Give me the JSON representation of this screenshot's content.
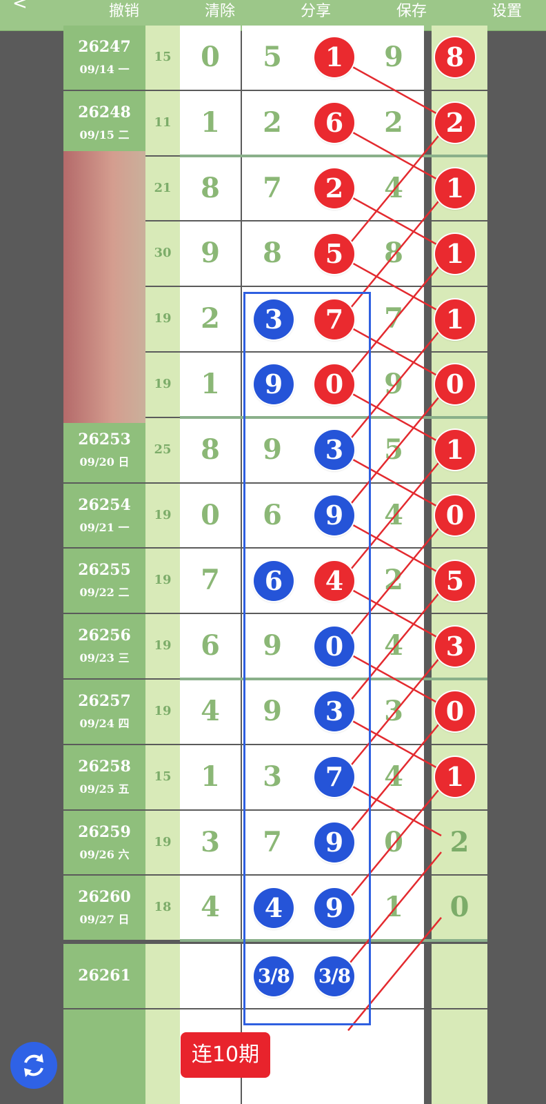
{
  "toolbar": {
    "back": "<",
    "undo": "撤销",
    "clear": "清除",
    "share": "分享",
    "save": "保存",
    "settings": "设置"
  },
  "colors": {
    "red_ball": "#ea2a2f",
    "blue_ball": "#2554d8",
    "green_header": "#9cc789"
  },
  "rows": [
    {
      "period": "26247",
      "date": "09/14 一",
      "sum": "15",
      "digits": [
        "0",
        "5",
        "1",
        "9",
        "8"
      ],
      "balls": {
        "2": "red",
        "4": "red"
      }
    },
    {
      "period": "26248",
      "date": "09/15 二",
      "sum": "11",
      "digits": [
        "1",
        "2",
        "6",
        "2",
        "2"
      ],
      "balls": {
        "2": "red",
        "4": "red"
      }
    },
    {
      "period": "",
      "date": "",
      "sum": "21",
      "digits": [
        "8",
        "7",
        "2",
        "4",
        "1"
      ],
      "balls": {
        "2": "red",
        "4": "red"
      }
    },
    {
      "period": "",
      "date": "",
      "sum": "30",
      "digits": [
        "9",
        "8",
        "5",
        "8",
        "1"
      ],
      "balls": {
        "2": "red",
        "4": "red"
      }
    },
    {
      "period": "",
      "date": "",
      "sum": "19",
      "digits": [
        "2",
        "3",
        "7",
        "7",
        "1"
      ],
      "balls": {
        "1": "blue",
        "2": "red",
        "4": "red"
      }
    },
    {
      "period": "",
      "date": "",
      "sum": "19",
      "digits": [
        "1",
        "9",
        "0",
        "9",
        "0"
      ],
      "balls": {
        "1": "blue",
        "2": "red",
        "4": "red"
      }
    },
    {
      "period": "26253",
      "date": "09/20 日",
      "sum": "25",
      "digits": [
        "8",
        "9",
        "3",
        "5",
        "1"
      ],
      "balls": {
        "2": "blue",
        "4": "red"
      }
    },
    {
      "period": "26254",
      "date": "09/21 一",
      "sum": "19",
      "digits": [
        "0",
        "6",
        "9",
        "4",
        "0"
      ],
      "balls": {
        "2": "blue",
        "4": "red"
      }
    },
    {
      "period": "26255",
      "date": "09/22 二",
      "sum": "19",
      "digits": [
        "7",
        "6",
        "4",
        "2",
        "5"
      ],
      "balls": {
        "1": "blue",
        "2": "red",
        "4": "red"
      }
    },
    {
      "period": "26256",
      "date": "09/23 三",
      "sum": "19",
      "digits": [
        "6",
        "9",
        "0",
        "4",
        "3"
      ],
      "balls": {
        "2": "blue",
        "4": "red"
      }
    },
    {
      "period": "26257",
      "date": "09/24 四",
      "sum": "19",
      "digits": [
        "4",
        "9",
        "3",
        "3",
        "0"
      ],
      "balls": {
        "2": "blue",
        "4": "red"
      }
    },
    {
      "period": "26258",
      "date": "09/25 五",
      "sum": "15",
      "digits": [
        "1",
        "3",
        "7",
        "4",
        "1"
      ],
      "balls": {
        "2": "blue",
        "4": "red"
      }
    },
    {
      "period": "26259",
      "date": "09/26 六",
      "sum": "19",
      "digits": [
        "3",
        "7",
        "9",
        "0",
        "2"
      ],
      "balls": {
        "2": "blue"
      }
    },
    {
      "period": "26260",
      "date": "09/27 日",
      "sum": "18",
      "digits": [
        "4",
        "4",
        "9",
        "1",
        "0"
      ],
      "balls": {
        "1": "blue",
        "2": "blue"
      }
    }
  ],
  "prediction": {
    "period": "26261",
    "values": [
      "3/8",
      "3/8"
    ]
  },
  "streak_badge": "连10期"
}
